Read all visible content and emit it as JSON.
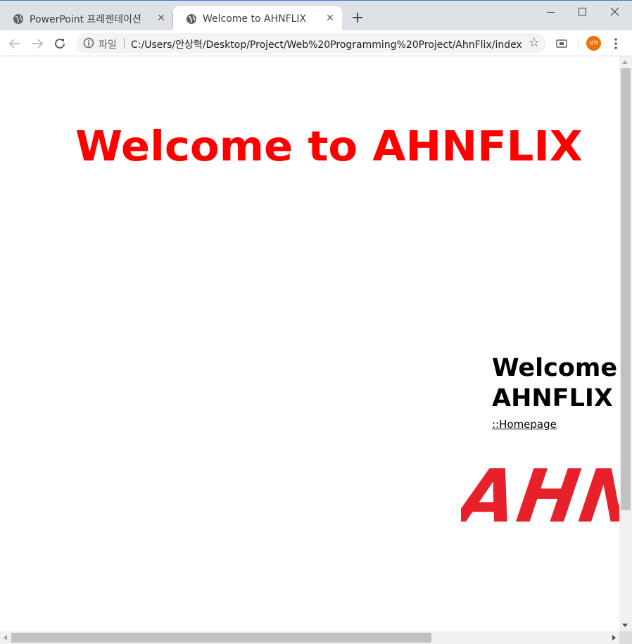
{
  "browser": {
    "tabs": [
      {
        "title": "PowerPoint 프레젠테이션",
        "icon": "globe-icon",
        "active": false
      },
      {
        "title": "Welcome to AHNFLIX",
        "icon": "globe-icon",
        "active": true
      }
    ],
    "new_tab_label": "+",
    "window_controls": {
      "minimize": "minimize",
      "maximize": "maximize",
      "close": "close"
    },
    "omnibox": {
      "scheme_label": "파일",
      "url": "C:/Users/안상혁/Desktop/Project/Web%20Programming%20Project/AhnFlix/index.html"
    },
    "profile_initials": "상혁",
    "accent_color": "#e8710a"
  },
  "page": {
    "hero_title": "Welcome to AHNFLIX",
    "hero_color": "#ff0000",
    "side_heading_line1": "Welcome to",
    "side_heading_line2": "AHNFLIX",
    "home_link": "::Homepage",
    "logo_text": "AHNFLIX",
    "logo_color": "#e8202a"
  }
}
